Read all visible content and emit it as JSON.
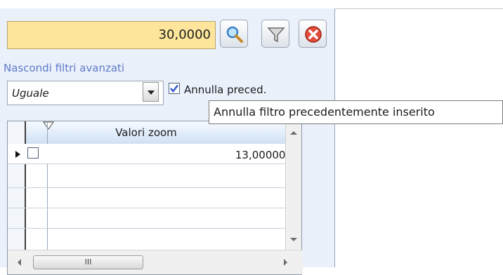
{
  "filter": {
    "value": "30,0000",
    "advanced_link": "Nascondi filtri avanzati",
    "operator": "Uguale",
    "annulla_label": "Annulla preced.",
    "annulla_checked": true,
    "buttons": {
      "search_icon": "magnifier-icon",
      "filter_icon": "funnel-icon",
      "clear_icon": "red-x-icon"
    }
  },
  "tooltip": {
    "text": "Annulla filtro precedentemente inserito"
  },
  "grid": {
    "column_header": "Valori zoom",
    "rows": [
      {
        "value": "13,000000",
        "checked": false,
        "current": true
      },
      {
        "value": ""
      },
      {
        "value": ""
      },
      {
        "value": ""
      }
    ],
    "hscroll_grip": "III"
  },
  "colors": {
    "panel": "#eaf1fb",
    "input_bg": "#fde69b",
    "link": "#5f79c9",
    "check_blue": "#2a55c7"
  }
}
